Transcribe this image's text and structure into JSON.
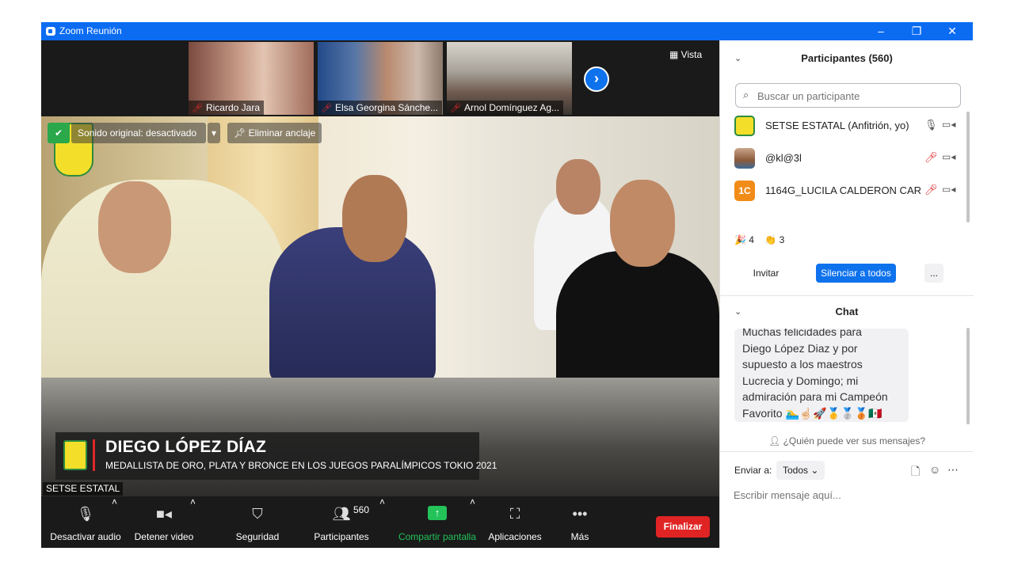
{
  "window": {
    "title": "Zoom Reunión",
    "min_icon": "minimize-icon",
    "restore_icon": "restore-icon",
    "close_icon": "close-icon"
  },
  "gallery": {
    "tiles": [
      {
        "name": "Ricardo Jara",
        "muted": true
      },
      {
        "name": "Elsa Georgina Sánche...",
        "muted": true
      },
      {
        "name": "Arnol Domínguez Ag...",
        "muted": true
      }
    ],
    "view_label": "Vista"
  },
  "main_video": {
    "original_sound": "Sonido original: desactivado",
    "unpin": "Eliminar anclaje",
    "caption_name": "DIEGO LÓPEZ DÍAZ",
    "caption_subtitle": "MEDALLISTA DE ORO, PLATA Y BRONCE EN LOS JUEGOS PARALÍMPICOS TOKIO 2021",
    "self_name": "SETSE ESTATAL"
  },
  "toolbar": {
    "audio": "Desactivar audio",
    "video": "Detener video",
    "security": "Seguridad",
    "participants": "Participantes",
    "participants_count": "560",
    "share": "Compartir pantalla",
    "apps": "Aplicaciones",
    "more": "Más",
    "end": "Finalizar"
  },
  "participants_panel": {
    "title": "Participantes (560)",
    "search_placeholder": "Buscar un participante",
    "rows": [
      {
        "name": "SETSE ESTATAL (Anfitrión, yo)",
        "avatar_color": "#f3df29",
        "muted": false
      },
      {
        "name": "@kl@3l",
        "avatar_color": "#8a5a3a",
        "muted": true
      },
      {
        "name": "1164G_LUCILA CALDERON CAR...",
        "avatar_text": "1C",
        "avatar_color": "#f28c18",
        "muted": true
      }
    ],
    "reactions": {
      "party": "4",
      "clap": "3"
    },
    "invite": "Invitar",
    "mute_all": "Silenciar a todos",
    "more": "..."
  },
  "chat": {
    "title": "Chat",
    "message_top": "Muchas felicidades para",
    "message_lines": [
      "Diego López Diaz y por",
      "supuesto a los maestros",
      "Lucrecia y Domingo; mi",
      "admiración para mi Campeón",
      "Favorito 🏊‍♂️☝🏻🚀🥇🥈🥉🇲🇽"
    ],
    "who_can_see": "¿Quién puede ver sus mensajes?",
    "send_to_label": "Enviar a:",
    "send_to_value": "Todos",
    "input_placeholder": "Escribir mensaje aquí..."
  },
  "colors": {
    "accent": "#0e72ed",
    "titlebar": "#0b6cf2",
    "end": "#e02424",
    "share_green": "#23c35a"
  }
}
